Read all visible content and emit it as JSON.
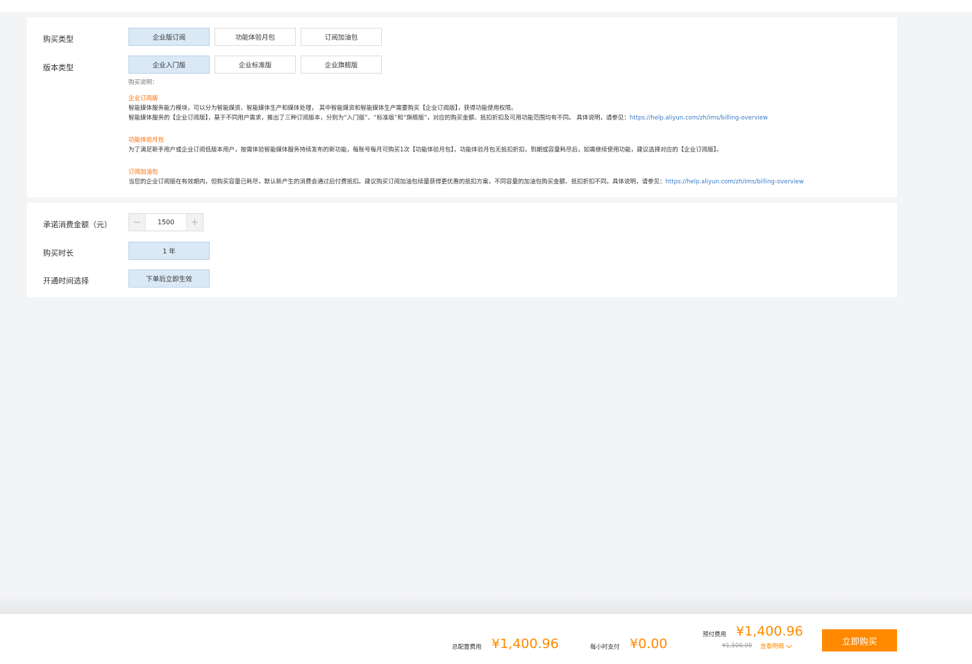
{
  "purchase_type": {
    "label": "购买类型",
    "options": [
      "企业版订阅",
      "功能体验月包",
      "订阅加油包"
    ],
    "selected_index": 0
  },
  "edition_type": {
    "label": "版本类型",
    "options": [
      "企业入门版",
      "企业标准版",
      "企业旗舰版"
    ],
    "selected_index": 0
  },
  "description": {
    "note": "购买说明：",
    "sections": [
      {
        "title": "企业订阅版",
        "line1": "智能媒体服务能力模块，可以分为智能媒资、智能媒体生产和媒体处理， 其中智能媒资和智能媒体生产需要购买【企业订阅版】，获得功能使用权限。",
        "line2": "智能媒体服务的【企业订阅版】，基于不同用户需求，推出了三种订阅版本，分别为“入门版”、“标准版”和“旗舰版”，对应的购买金额、抵扣折扣及可用功能范围均有不同。 具体说明，请参见：",
        "link": "https://help.aliyun.com/zh/ims/billing-overview"
      },
      {
        "title": "功能体验月包",
        "line1": "为了满足新手用户或企业订阅低版本用户，按需体验智能媒体服务持续发布的新功能，每账号每月可购买1次【功能体验月包】，功能体验月包无抵扣折扣，到期或容量耗尽后，如需继续使用功能，建议选择对应的【企业订阅版】。"
      },
      {
        "title": "订阅加油包",
        "line1": "当您的企业订阅版在有效期内，但购买容量已耗尽，默认新产生的消费会通过后付费抵扣。建议购买订阅加油包续量获得更优惠的抵扣方案，不同容量的加油包购买金额、抵扣折扣不同。具体说明，请参见：",
        "link": "https://help.aliyun.com/zh/ims/billing-overview"
      }
    ]
  },
  "commitment": {
    "label": "承诺消费金额（元）",
    "value": "1500",
    "minus": "−",
    "plus": "+"
  },
  "duration": {
    "label": "购买时长",
    "value": "1 年"
  },
  "activation": {
    "label": "开通时间选择",
    "value": "下单后立即生效"
  },
  "footer": {
    "total_label": "总配置费用",
    "total_price": "¥1,400.96",
    "hourly_label": "每小时支付",
    "hourly_price": "¥0.00",
    "prepaid_label": "预付费用",
    "prepaid_price": "¥1,400.96",
    "original_price": "¥1,500.00",
    "detail_label": "查看明细",
    "buy_label": "立即购买"
  },
  "colors": {
    "accent_orange": "#ff8a00",
    "selected_bg": "#dbe9f6",
    "link_blue": "#3b7bc8"
  }
}
